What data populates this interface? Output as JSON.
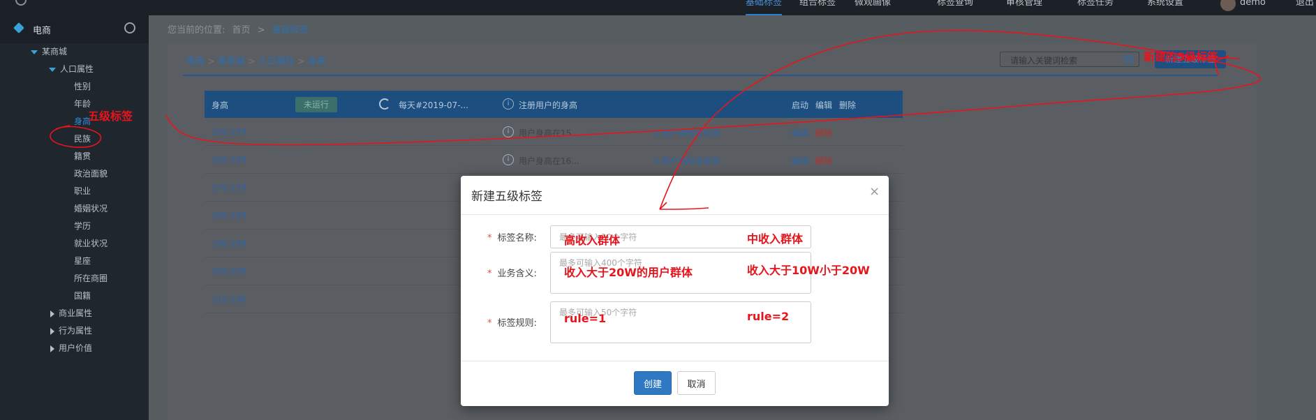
{
  "topnav": {
    "items": [
      "基础标签",
      "组合标签",
      "微观画像",
      "标签查询",
      "审核管理",
      "标签任务",
      "系统设置"
    ],
    "active_index": 0,
    "user_name": "demo",
    "logout": "退出"
  },
  "sidebar": {
    "title": "电商",
    "tree": [
      {
        "label": "某商城",
        "level": 1,
        "state": "open"
      },
      {
        "label": "人口属性",
        "level": 2,
        "state": "open"
      },
      {
        "label": "性别",
        "level": 3
      },
      {
        "label": "年龄",
        "level": 3
      },
      {
        "label": "身高",
        "level": 3,
        "selected": true
      },
      {
        "label": "民族",
        "level": 3
      },
      {
        "label": "籍贯",
        "level": 3
      },
      {
        "label": "政治面貌",
        "level": 3
      },
      {
        "label": "职业",
        "level": 3
      },
      {
        "label": "婚姻状况",
        "level": 3
      },
      {
        "label": "学历",
        "level": 3
      },
      {
        "label": "就业状况",
        "level": 3
      },
      {
        "label": "星座",
        "level": 3
      },
      {
        "label": "所在商圈",
        "level": 3
      },
      {
        "label": "国籍",
        "level": 3
      },
      {
        "label": "商业属性",
        "level": 2,
        "state": "closed"
      },
      {
        "label": "行为属性",
        "level": 2,
        "state": "closed"
      },
      {
        "label": "用户价值",
        "level": 2,
        "state": "closed"
      }
    ]
  },
  "breadcrumb_top": {
    "prefix": "您当前的位置:",
    "home": "首页",
    "sep": ">",
    "current": "基础标签"
  },
  "breadcrumb_inner": [
    "电商",
    "某商城",
    "人口属性",
    "身高"
  ],
  "search": {
    "placeholder": "请输入关键词检索"
  },
  "new_button": "新建五级标签",
  "table_header": {
    "name": "身高",
    "status": "未运行",
    "schedule": "每天#2019-07-...",
    "desc": "注册用户的身高",
    "actions": [
      "启动",
      "编辑",
      "删除"
    ]
  },
  "rows": [
    {
      "name": "150-159",
      "desc": "用户身高在15...",
      "count": "0 用户拥有该标签",
      "edit": "编辑",
      "delete": "删除"
    },
    {
      "name": "160-169",
      "desc": "用户身高在16...",
      "count": "0 用户拥有该标签",
      "edit": "编辑",
      "delete": "删除"
    },
    {
      "name": "170-179"
    },
    {
      "name": "180-189"
    },
    {
      "name": "190-199"
    },
    {
      "name": "200-209"
    },
    {
      "name": "210-240"
    }
  ],
  "modal": {
    "title": "新建五级标签",
    "close": "×",
    "fields": [
      {
        "label": "标签名称:",
        "placeholder": "最多可输入20个字符",
        "value": ""
      },
      {
        "label": "业务含义:",
        "placeholder": "最多可输入400个字符",
        "value": ""
      },
      {
        "label": "标签规则:",
        "placeholder": "最多可输入50个字符",
        "value": ""
      }
    ],
    "required_mark": "*",
    "create": "创建",
    "cancel": "取消"
  },
  "annotations": {
    "level5": "五级标签",
    "new5": "新建的5级标签",
    "name1": "高收入群体",
    "name2": "中收入群体",
    "desc1": "收入大于20W的用户群体",
    "desc2": "收入大于10W小于20W",
    "rule1": "rule=1",
    "rule2": "rule=2",
    "color": "#e8141c"
  }
}
